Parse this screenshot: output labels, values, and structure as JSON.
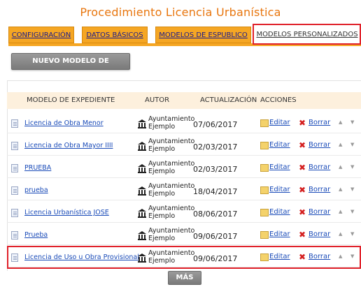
{
  "page": {
    "title": "Procedimiento Licencia Urbanística"
  },
  "tabs": [
    {
      "label": "CONFIGURACIÓN",
      "active": false
    },
    {
      "label": "DATOS BÁSICOS",
      "active": false
    },
    {
      "label": "MODELOS DE ESPUBLICO",
      "active": false
    },
    {
      "label": "MODELOS PERSONALIZADOS",
      "active": true
    }
  ],
  "toolbar": {
    "new_button_label": "NUEVO MODELO DE EXPEDIENTE"
  },
  "table": {
    "headers": {
      "model": "MODELO DE EXPEDIENTE",
      "author": "AUTOR",
      "updated": "ACTUALIZACIÓN",
      "actions": "ACCIONES"
    },
    "rows": [
      {
        "name": "Licencia de Obra Menor",
        "author_line1": "Ayuntamiento",
        "author_line2": "Ejemplo",
        "date": "07/06/2017",
        "edit": "Editar",
        "delete": "Borrar"
      },
      {
        "name": "Licencia de Obra Mayor IIII",
        "author_line1": "Ayuntamiento",
        "author_line2": "Ejemplo",
        "date": "02/03/2017",
        "edit": "Editar",
        "delete": "Borrar"
      },
      {
        "name": "PRUEBA",
        "author_line1": "Ayuntamiento",
        "author_line2": "Ejemplo",
        "date": "02/03/2017",
        "edit": "Editar",
        "delete": "Borrar"
      },
      {
        "name": "prueba",
        "author_line1": "Ayuntamiento",
        "author_line2": "Ejemplo",
        "date": "18/04/2017",
        "edit": "Editar",
        "delete": "Borrar"
      },
      {
        "name": "Licencia Urbanística JOSE",
        "author_line1": "Ayuntamiento",
        "author_line2": "Ejemplo",
        "date": "08/06/2017",
        "edit": "Editar",
        "delete": "Borrar"
      },
      {
        "name": "Prueba",
        "author_line1": "Ayuntamiento",
        "author_line2": "Ejemplo",
        "date": "09/06/2017",
        "edit": "Editar",
        "delete": "Borrar"
      },
      {
        "name": "Licencia de Uso u Obra Provisional",
        "author_line1": "Ayuntamiento",
        "author_line2": "Ejemplo",
        "date": "09/06/2017",
        "edit": "Editar",
        "delete": "Borrar"
      }
    ]
  },
  "footer": {
    "more_button_label": "MÁS"
  },
  "colors": {
    "accent": "#f5a623",
    "title": "#e8760e",
    "highlight": "#e0212a",
    "link": "#1a4bb8"
  },
  "icons": {
    "document": "document-icon",
    "author": "town-hall-icon",
    "edit": "pencil-icon",
    "delete": "x-icon",
    "move_up": "arrow-up-icon",
    "move_down": "arrow-down-icon"
  }
}
